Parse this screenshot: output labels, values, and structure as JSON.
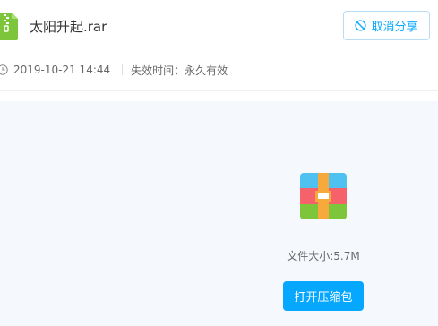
{
  "file": {
    "name": "太阳升起.rar",
    "icon": "zip-file-icon"
  },
  "actions": {
    "cancel_share_label": "取消分享",
    "cancel_share_icon": "ban-icon",
    "open_archive_label": "打开压缩包"
  },
  "meta": {
    "created": "2019-10-21 14:44",
    "expiry": "失效时间：永久有效"
  },
  "preview": {
    "icon": "archive-icon",
    "size_text": "文件大小:5.7M"
  },
  "colors": {
    "accent": "#06a7ff",
    "file_icon_green": "#7dc53b",
    "content_bg": "#f5f8fc"
  }
}
